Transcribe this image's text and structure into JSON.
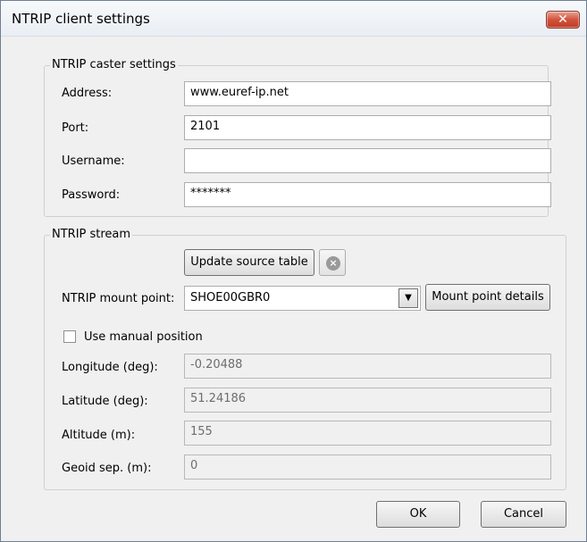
{
  "window": {
    "title": "NTRIP client settings",
    "close_glyph": "✕"
  },
  "caster": {
    "group_label": "NTRIP caster settings",
    "address_label": "Address:",
    "address_value": "www.euref-ip.net",
    "port_label": "Port:",
    "port_value": "2101",
    "username_label": "Username:",
    "username_value": "",
    "password_label": "Password:",
    "password_value": "*******"
  },
  "stream": {
    "group_label": "NTRIP stream",
    "update_button": "Update source table",
    "mount_label": "NTRIP mount point:",
    "mount_value": "SHOE00GBR0",
    "mount_details_button": "Mount point details",
    "manual_position_label": "Use manual position",
    "manual_position_checked": false,
    "longitude_label": "Longitude (deg):",
    "longitude_value": "-0.20488",
    "latitude_label": "Latitude (deg):",
    "latitude_value": "51.24186",
    "altitude_label": "Altitude (m):",
    "altitude_value": "155",
    "geoid_label": "Geoid sep. (m):",
    "geoid_value": "0"
  },
  "footer": {
    "ok_label": "OK",
    "cancel_label": "Cancel"
  },
  "icons": {
    "close": "close-icon",
    "cancel_update": "cancel-circle-icon",
    "dropdown": "chevron-down-icon"
  }
}
